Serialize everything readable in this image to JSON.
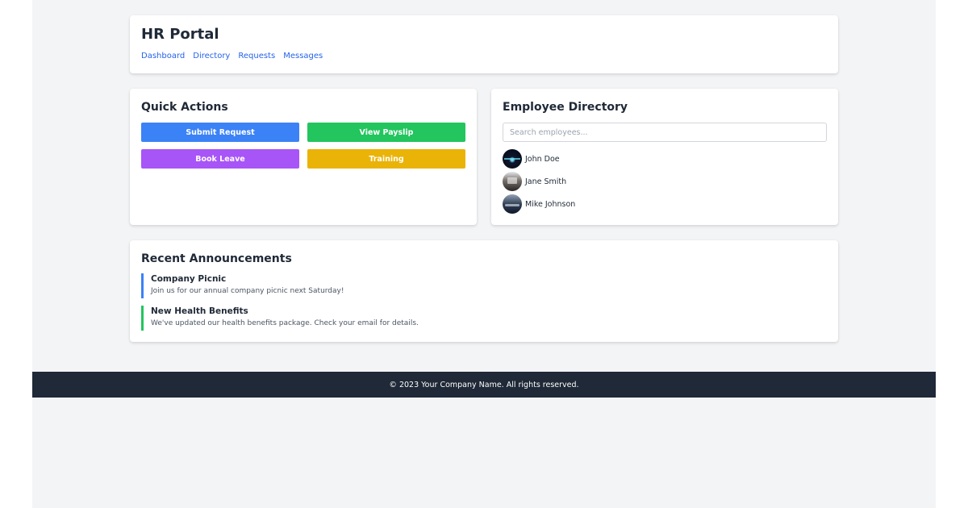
{
  "header": {
    "title": "HR Portal",
    "nav": [
      "Dashboard",
      "Directory",
      "Requests",
      "Messages"
    ]
  },
  "quick_actions": {
    "title": "Quick Actions",
    "buttons": [
      {
        "label": "Submit Request",
        "color": "#3b82f6"
      },
      {
        "label": "View Payslip",
        "color": "#22c55e"
      },
      {
        "label": "Book Leave",
        "color": "#a855f7"
      },
      {
        "label": "Training",
        "color": "#eab308"
      }
    ]
  },
  "directory": {
    "title": "Employee Directory",
    "search_placeholder": "Search employees...",
    "employees": [
      {
        "name": "John Doe",
        "avatar": "photo-avatar"
      },
      {
        "name": "Jane Smith",
        "avatar": "photo-avatar"
      },
      {
        "name": "Mike Johnson",
        "avatar": "photo-avatar"
      }
    ]
  },
  "announcements": {
    "title": "Recent Announcements",
    "items": [
      {
        "title": "Company Picnic",
        "body": "Join us for our annual company picnic next Saturday!",
        "accent": "#3b82f6"
      },
      {
        "title": "New Health Benefits",
        "body": "We've updated our health benefits package. Check your email for details.",
        "accent": "#22c55e"
      }
    ]
  },
  "footer": {
    "text": "© 2023 Your Company Name. All rights reserved."
  },
  "colors": {
    "page_bg": "#f3f4f6",
    "footer_bg": "#1f2937",
    "link": "#2563eb"
  }
}
